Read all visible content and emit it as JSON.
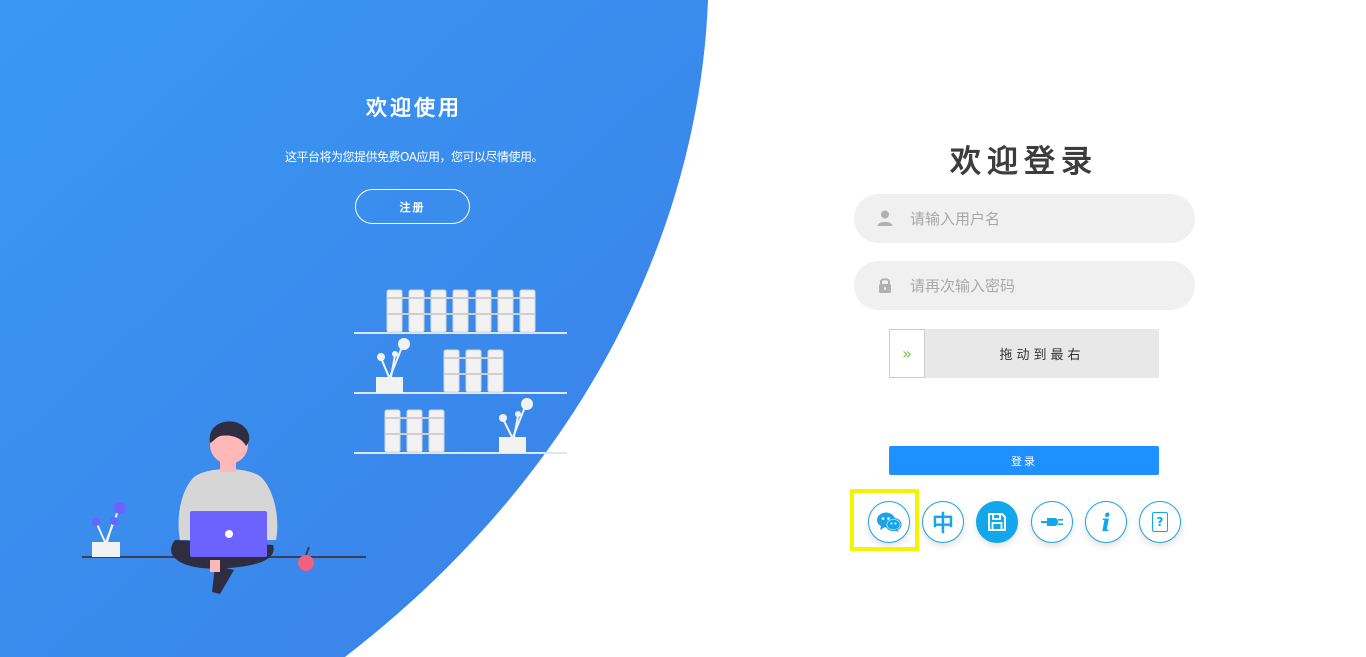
{
  "left_panel": {
    "title": "欢迎使用",
    "subtitle": "这平台将为您提供免费OA应用，您可以尽情使用。",
    "register_label": "注册"
  },
  "login": {
    "title": "欢迎登录",
    "username_placeholder": "请输入用户名",
    "password_placeholder": "请再次输入密码",
    "slider_text": "拖动到最右",
    "slider_handle_glyph": "»",
    "login_label": "登录"
  },
  "tool_icons": {
    "chinese_label": "中",
    "info_label": "i",
    "help_label": "?"
  },
  "colors": {
    "primary_blue": "#1e90ff",
    "icon_blue": "#12a7ea",
    "highlight": "#f4f400",
    "slider_arrow": "#7ac143"
  }
}
